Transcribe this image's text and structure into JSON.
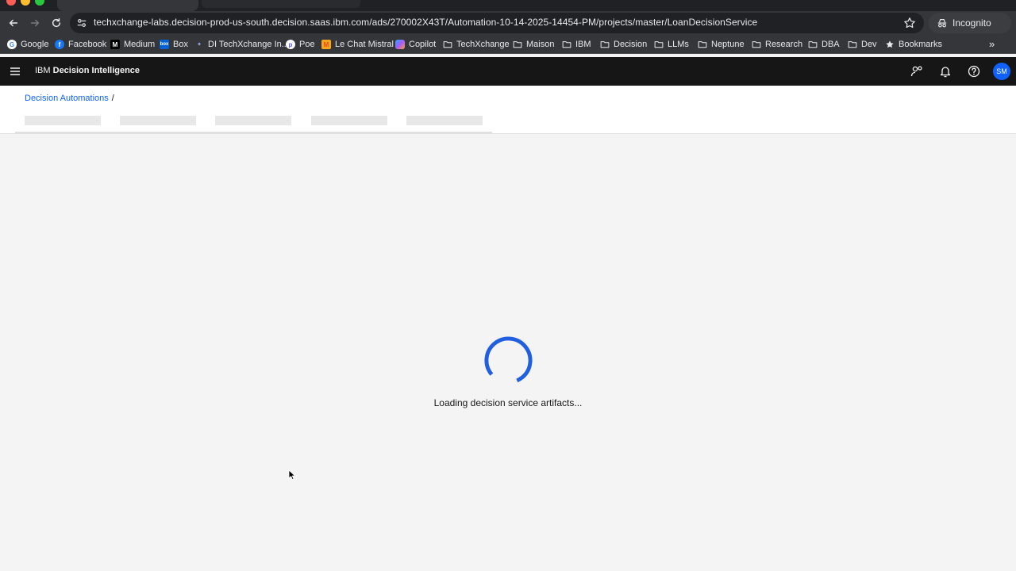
{
  "browser": {
    "url": "techxchange-labs.decision-prod-us-south.decision.saas.ibm.com/ads/270002X43T/Automation-10-14-2025-14454-PM/projects/master/LoanDecisionService",
    "profile_label": "Incognito",
    "bookmarks": [
      {
        "label": "Google",
        "icon": "google-icon"
      },
      {
        "label": "Facebook",
        "icon": "facebook-icon"
      },
      {
        "label": "Medium",
        "icon": "medium-icon"
      },
      {
        "label": "Box",
        "icon": "box-icon"
      },
      {
        "label": "DI TechXchange In...",
        "icon": "ibm-icon"
      },
      {
        "label": "Poe",
        "icon": "poe-icon"
      },
      {
        "label": "Le Chat Mistral",
        "icon": "mistral-icon"
      },
      {
        "label": "Copilot",
        "icon": "copilot-icon"
      },
      {
        "label": "TechXchange",
        "icon": "folder-icon"
      },
      {
        "label": "Maison",
        "icon": "folder-icon"
      },
      {
        "label": "IBM",
        "icon": "folder-icon"
      },
      {
        "label": "Decision",
        "icon": "folder-icon"
      },
      {
        "label": "LLMs",
        "icon": "folder-icon"
      },
      {
        "label": "Neptune",
        "icon": "folder-icon"
      },
      {
        "label": "Research",
        "icon": "folder-icon"
      },
      {
        "label": "DBA",
        "icon": "folder-icon"
      },
      {
        "label": "Dev",
        "icon": "folder-icon"
      },
      {
        "label": "Bookmarks",
        "icon": "star-icon"
      }
    ],
    "more_bookmarks_glyph": "»"
  },
  "header": {
    "brand_prefix": "IBM",
    "brand_name": "Decision Intelligence",
    "avatar_initials": "SM"
  },
  "breadcrumb": {
    "link": "Decision Automations",
    "separator": "/"
  },
  "loader": {
    "message": "Loading decision service artifacts..."
  },
  "colors": {
    "accent": "#0f62fe",
    "spinner": "#1f5fe0",
    "header_bg": "#161616",
    "page_bg": "#f4f4f4"
  }
}
